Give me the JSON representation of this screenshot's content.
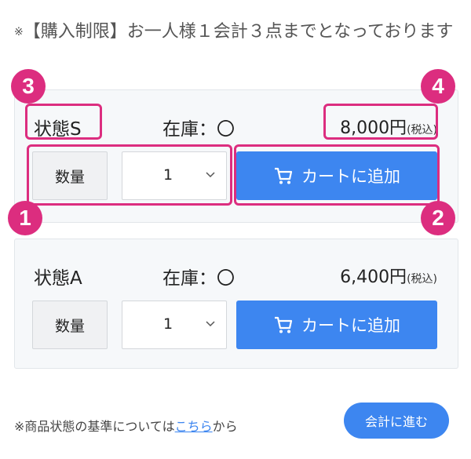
{
  "notice": {
    "mark": "※",
    "text": "【購入制限】お一人様１会計３点までとなっております"
  },
  "products": [
    {
      "condition": "状態S",
      "stock": "在庫：〇",
      "price": "8,000円",
      "tax": "(税込)",
      "qty_label": "数量",
      "qty_value": "1",
      "cart_label": "カートに追加"
    },
    {
      "condition": "状態A",
      "stock": "在庫：〇",
      "price": "6,400円",
      "tax": "(税込)",
      "qty_label": "数量",
      "qty_value": "1",
      "cart_label": "カートに追加"
    }
  ],
  "callouts": [
    "1",
    "2",
    "3",
    "4"
  ],
  "footer": {
    "note_prefix": "※商品状態の基準については",
    "note_link": "こちら",
    "note_suffix": "から",
    "checkout_label": "会計に進む"
  },
  "colors": {
    "accent": "#3d86f0",
    "highlight": "#dc2d7f"
  },
  "icons": {
    "cart": "cart-icon",
    "chevron": "chevron-down-icon"
  }
}
